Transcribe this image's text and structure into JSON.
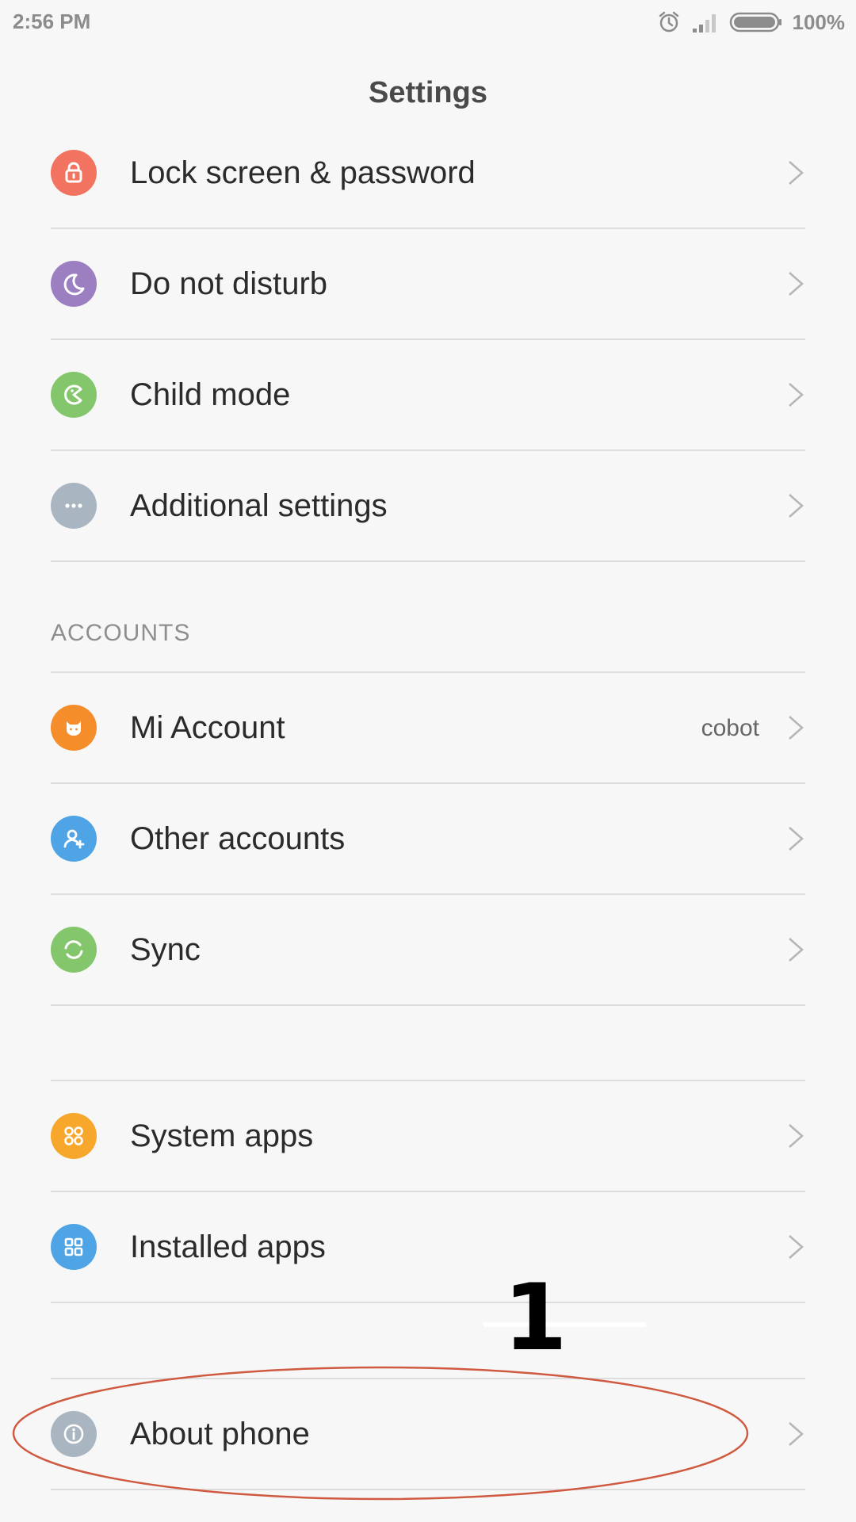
{
  "status_bar": {
    "time": "2:56 PM",
    "battery_percent": "100%",
    "icons": [
      "alarm-icon",
      "signal-icon",
      "battery-icon"
    ],
    "battery_level": 1.0
  },
  "header": {
    "title": "Settings"
  },
  "colors": {
    "background": "#f7f7f7",
    "lock": "#f2735f",
    "dnd": "#9b7fc1",
    "child": "#84c66b",
    "additional": "#a9b5c0",
    "mi_account": "#f58d2b",
    "other_accounts": "#4fa4e5",
    "sync": "#84c66b",
    "system_apps": "#f7a72b",
    "installed_apps": "#4fa4e5",
    "about": "#a9b5c0",
    "annotation": "#cf5a3f"
  },
  "general": {
    "items": [
      {
        "label": "Lock screen & password",
        "icon": "lock-icon"
      },
      {
        "label": "Do not disturb",
        "icon": "moon-icon"
      },
      {
        "label": "Child mode",
        "icon": "child-mode-icon"
      },
      {
        "label": "Additional settings",
        "icon": "more-icon"
      }
    ]
  },
  "accounts": {
    "header": "ACCOUNTS",
    "items": [
      {
        "label": "Mi Account",
        "value": "cobot",
        "icon": "mi-account-icon"
      },
      {
        "label": "Other accounts",
        "icon": "add-user-icon"
      },
      {
        "label": "Sync",
        "icon": "sync-icon"
      }
    ]
  },
  "apps": {
    "items": [
      {
        "label": "System apps",
        "icon": "system-apps-icon"
      },
      {
        "label": "Installed apps",
        "icon": "installed-apps-icon"
      }
    ]
  },
  "about": {
    "label": "About phone",
    "icon": "info-icon"
  },
  "annotation": {
    "number": "1"
  }
}
